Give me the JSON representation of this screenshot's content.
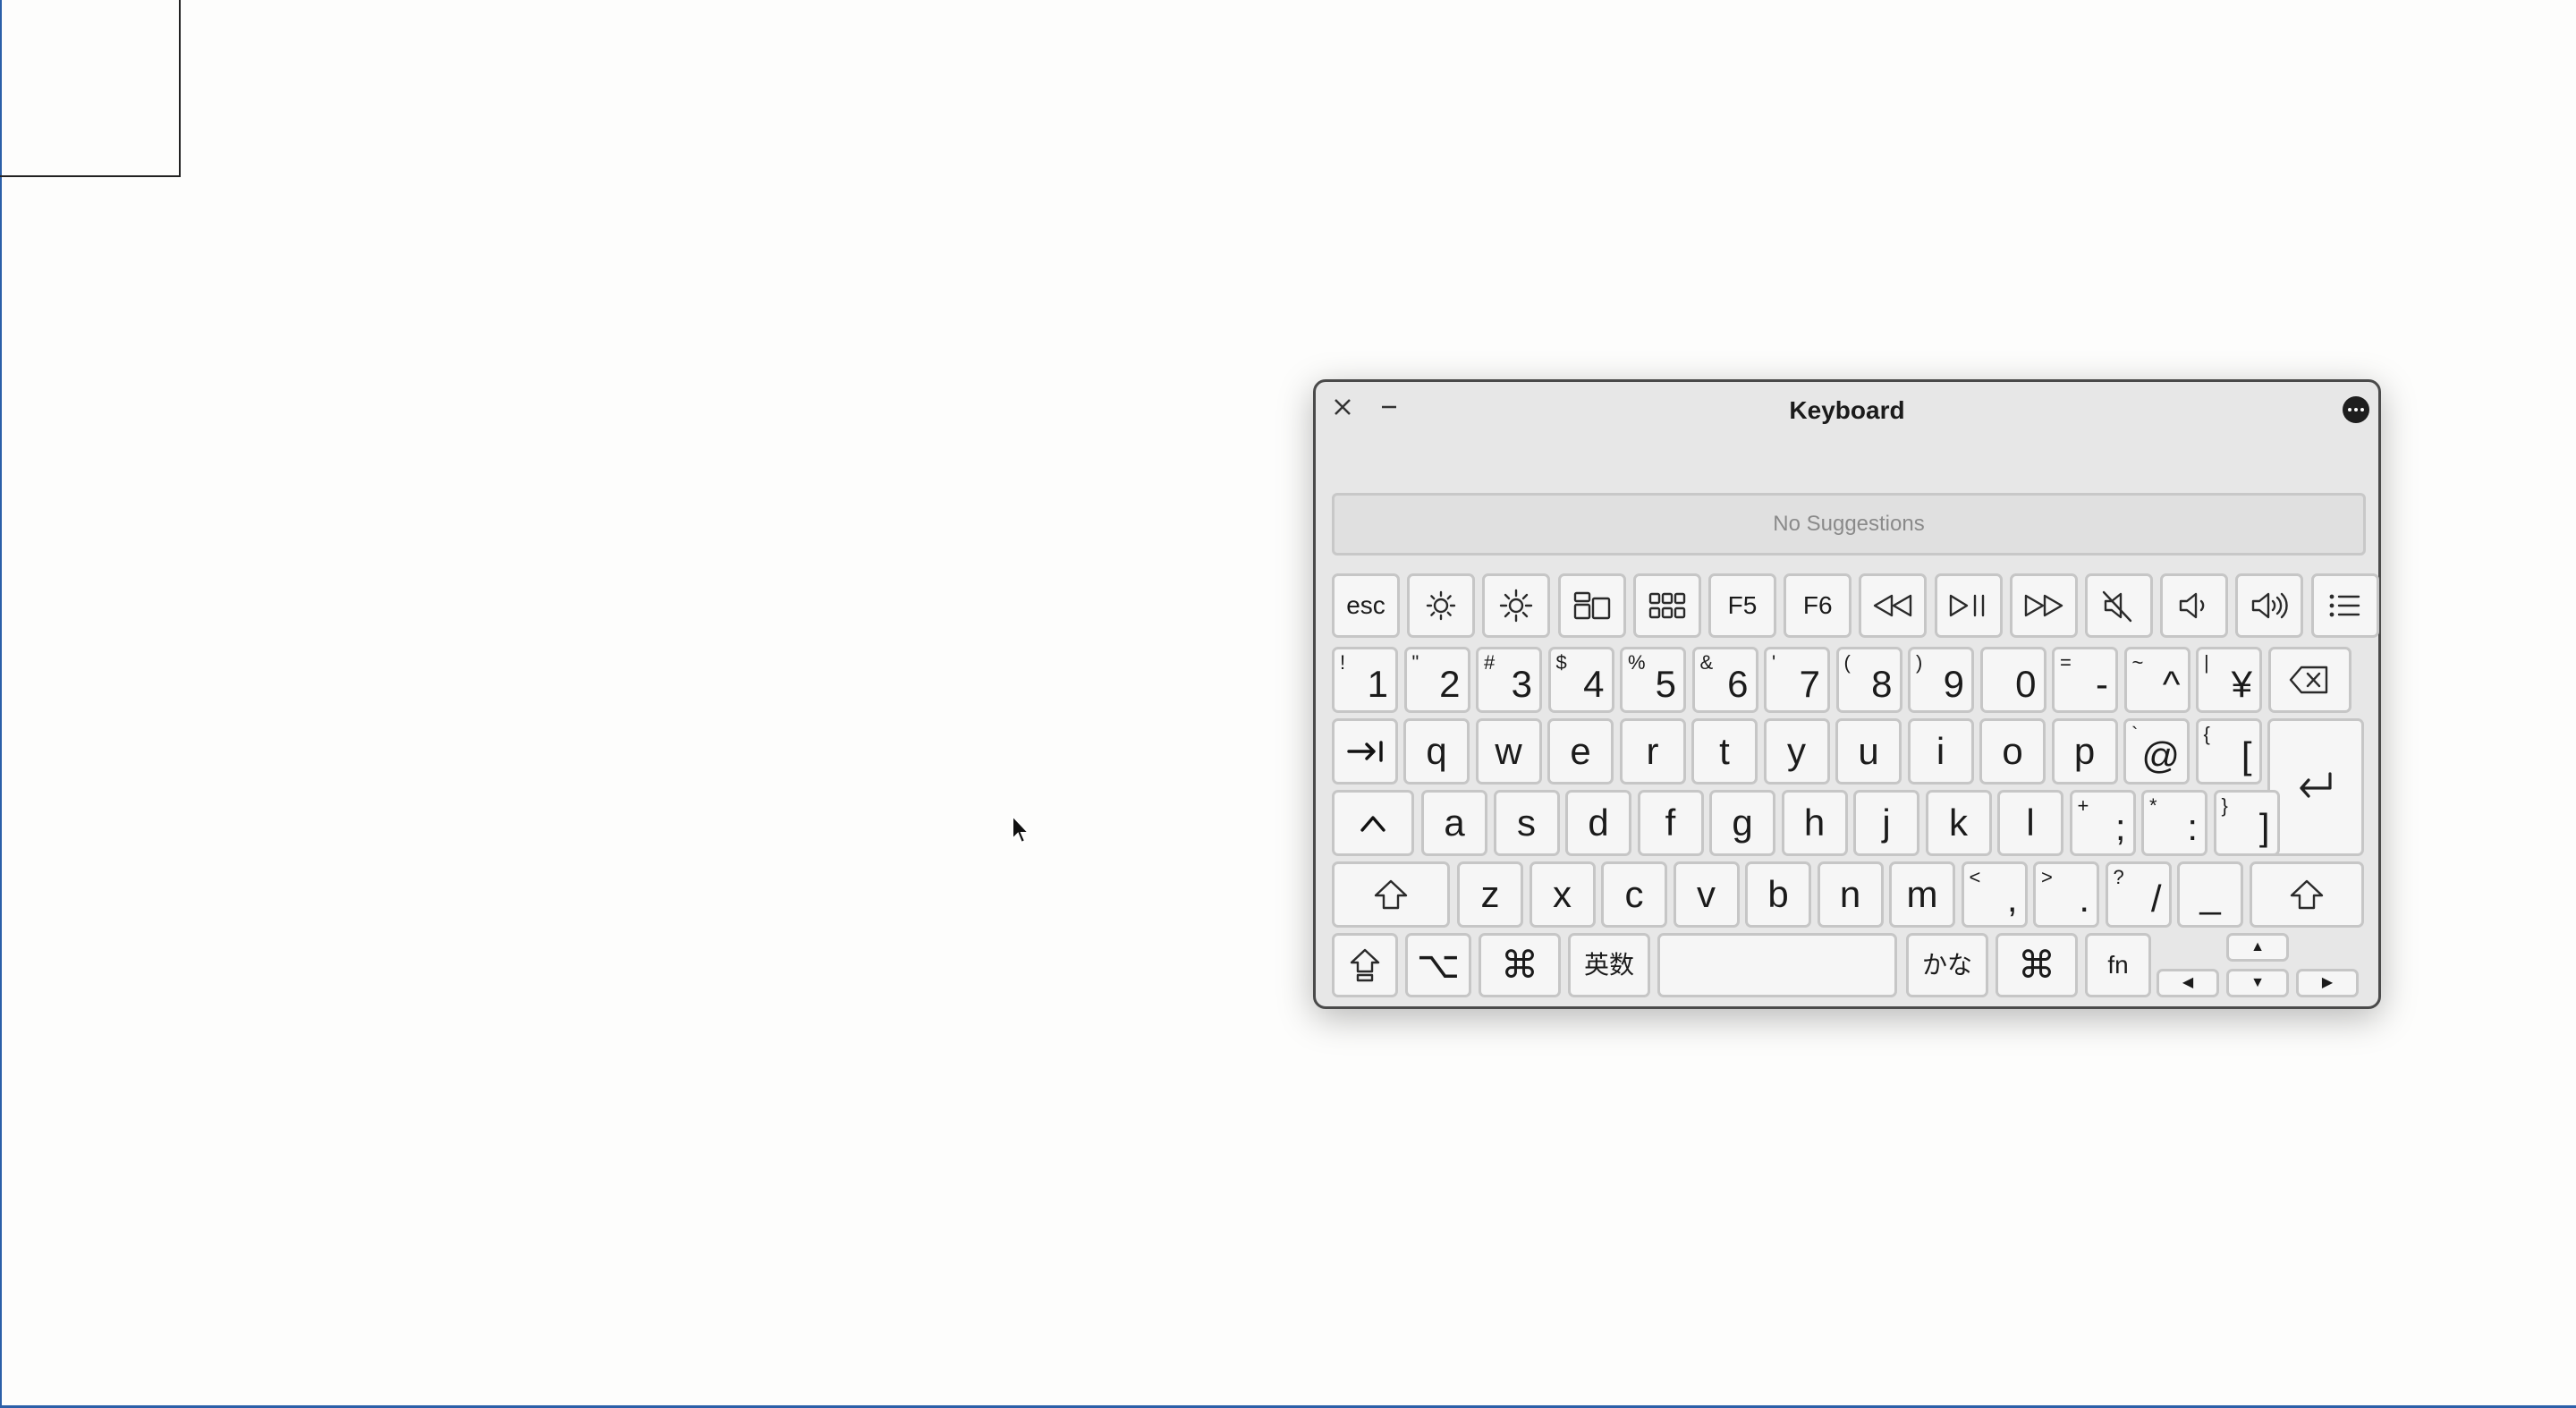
{
  "window": {
    "title": "Keyboard"
  },
  "suggestions": {
    "text": "No Suggestions"
  },
  "function_row": {
    "esc": "esc",
    "f5": "F5",
    "f6": "F6",
    "icons": [
      "brightness-down-icon",
      "brightness-up-icon",
      "mission-control-icon",
      "launchpad-icon",
      "rewind-icon",
      "play-pause-icon",
      "fast-forward-icon",
      "mute-icon",
      "volume-down-icon",
      "volume-up-icon",
      "list-icon"
    ]
  },
  "number_row": [
    {
      "main": "1",
      "alt": "!"
    },
    {
      "main": "2",
      "alt": "\""
    },
    {
      "main": "3",
      "alt": "#"
    },
    {
      "main": "4",
      "alt": "$"
    },
    {
      "main": "5",
      "alt": "%"
    },
    {
      "main": "6",
      "alt": "&"
    },
    {
      "main": "7",
      "alt": "'"
    },
    {
      "main": "8",
      "alt": "("
    },
    {
      "main": "9",
      "alt": ")"
    },
    {
      "main": "0",
      "alt": ""
    },
    {
      "main": "-",
      "alt": "="
    },
    {
      "main": "^",
      "alt": "~"
    },
    {
      "main": "¥",
      "alt": "|"
    }
  ],
  "row_q": [
    {
      "main": "q"
    },
    {
      "main": "w"
    },
    {
      "main": "e"
    },
    {
      "main": "r"
    },
    {
      "main": "t"
    },
    {
      "main": "y"
    },
    {
      "main": "u"
    },
    {
      "main": "i"
    },
    {
      "main": "o"
    },
    {
      "main": "p"
    },
    {
      "main": "@",
      "alt": "`"
    },
    {
      "main": "[",
      "alt": "{"
    }
  ],
  "row_a": [
    {
      "main": "a"
    },
    {
      "main": "s"
    },
    {
      "main": "d"
    },
    {
      "main": "f"
    },
    {
      "main": "g"
    },
    {
      "main": "h"
    },
    {
      "main": "j"
    },
    {
      "main": "k"
    },
    {
      "main": "l"
    },
    {
      "main": ";",
      "alt": "+"
    },
    {
      "main": ":",
      "alt": "*"
    },
    {
      "main": "]",
      "alt": "}"
    }
  ],
  "row_a_control": "^",
  "row_z": [
    {
      "main": "z"
    },
    {
      "main": "x"
    },
    {
      "main": "c"
    },
    {
      "main": "v"
    },
    {
      "main": "b"
    },
    {
      "main": "n"
    },
    {
      "main": "m"
    },
    {
      "main": ",",
      "alt": "<"
    },
    {
      "main": ".",
      "alt": ">"
    },
    {
      "main": "/",
      "alt": "?"
    },
    {
      "main": "_",
      "alt": ""
    }
  ],
  "bottom_row": {
    "option": "⌥",
    "command_left": "⌘",
    "eisu": "英数",
    "space": "",
    "kana": "かな",
    "command_right": "⌘",
    "fn": "fn",
    "arrow_up": "▲",
    "arrow_left": "◀",
    "arrow_down": "▼",
    "arrow_right": "▶"
  }
}
